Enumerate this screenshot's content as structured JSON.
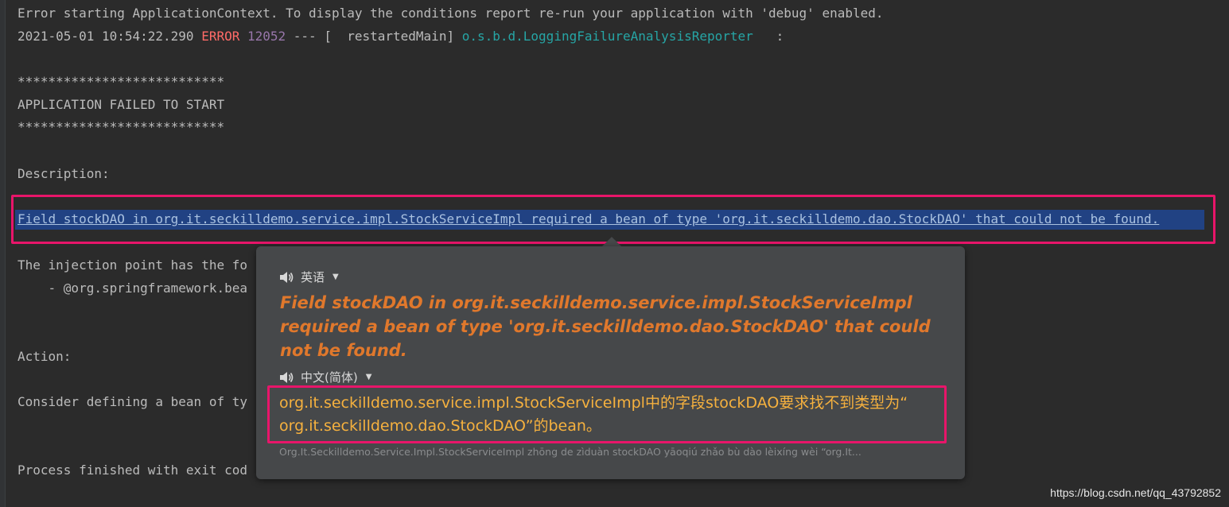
{
  "console": {
    "line1": "Error starting ApplicationContext. To display the conditions report re-run your application with 'debug' enabled.",
    "line2": {
      "timestamp": "2021-05-01 10:54:22.290 ",
      "level": "ERROR",
      "pid": " 12052",
      "sep": " --- [  restartedMain] ",
      "logger": "o.s.b.d.LoggingFailureAnalysisReporter",
      "colon": "   :"
    },
    "stars1": "***************************",
    "banner": "APPLICATION FAILED TO START",
    "stars2": "***************************",
    "description_label": "Description:",
    "field_line": "Field stockDAO in org.it.seckilldemo.service.impl.StockServiceImpl required a bean of type 'org.it.seckilldemo.dao.StockDAO' that could not be found.",
    "injection_line": "The injection point has the fo",
    "annotation_line": "    - @org.springframework.bea",
    "action_label": "Action:",
    "consider_line": "Consider defining a bean of ty",
    "process_line": "Process finished with exit cod"
  },
  "colors": {
    "error": "#ff6b68",
    "pid": "#9876aa",
    "logger": "#26a5a5",
    "highlight_box": "#e8156a",
    "source_text": "#e0782c",
    "target_text": "#f6b13e"
  },
  "translation_popup": {
    "source_lang": "英语",
    "source_text": "Field stockDAO in org.it.seckilldemo.service.impl.StockServiceImpl required a bean of type 'org.it.seckilldemo.dao.StockDAO' that could not be found.",
    "target_lang": "中文(简体)",
    "target_text": "org.it.seckilldemo.service.impl.StockServiceImpl中的字段stockDAO要求找不到类型为“ org.it.seckilldemo.dao.StockDAO”的bean。",
    "pinyin": "Org.It.Seckilldemo.Service.Impl.StockServiceImpl zhōng de zìduàn stockDAO yāoqiú zhǎo bù dào lèixíng wèi “org.It...",
    "speaker_icon": "speaker-icon",
    "dropdown_icon": "caret-down-icon"
  },
  "watermark": "https://blog.csdn.net/qq_43792852"
}
